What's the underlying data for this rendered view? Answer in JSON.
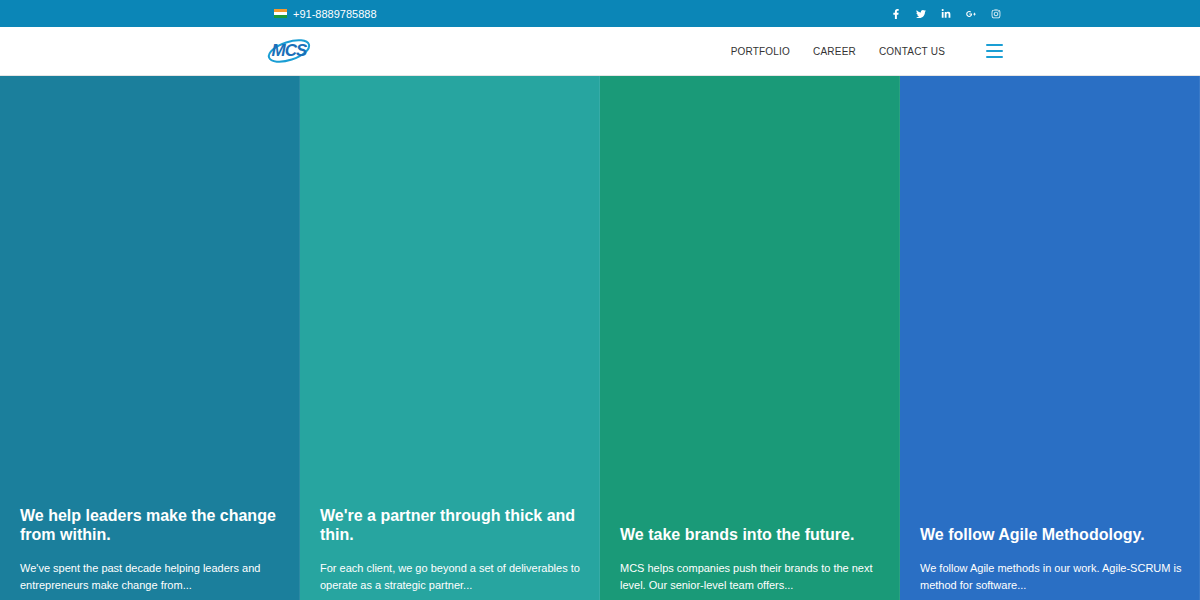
{
  "topbar": {
    "phone": "+91-8889785888"
  },
  "logo": {
    "text": "MCS"
  },
  "nav": [
    {
      "label": "PORTFOLIO"
    },
    {
      "label": "CAREER"
    },
    {
      "label": "CONTACT US"
    }
  ],
  "panels": [
    {
      "title": "We help leaders make the change from within.",
      "description": "We've spent the past decade helping leaders and entrepreneurs make change from...",
      "color": "#1b7f9c"
    },
    {
      "title": "We're a partner through thick and thin.",
      "description": "For each client, we go beyond a set of deliverables to operate as a strategic partner...",
      "color": "#27a5a0"
    },
    {
      "title": "We take brands into the future.",
      "description": "MCS helps companies push their brands to the next level. Our senior-level team offers...",
      "color": "#1a9a78"
    },
    {
      "title": "We follow Agile Methodology.",
      "description": "We follow Agile methods in our work. Agile-SCRUM is method for software...",
      "color": "#2a6fc4"
    }
  ]
}
